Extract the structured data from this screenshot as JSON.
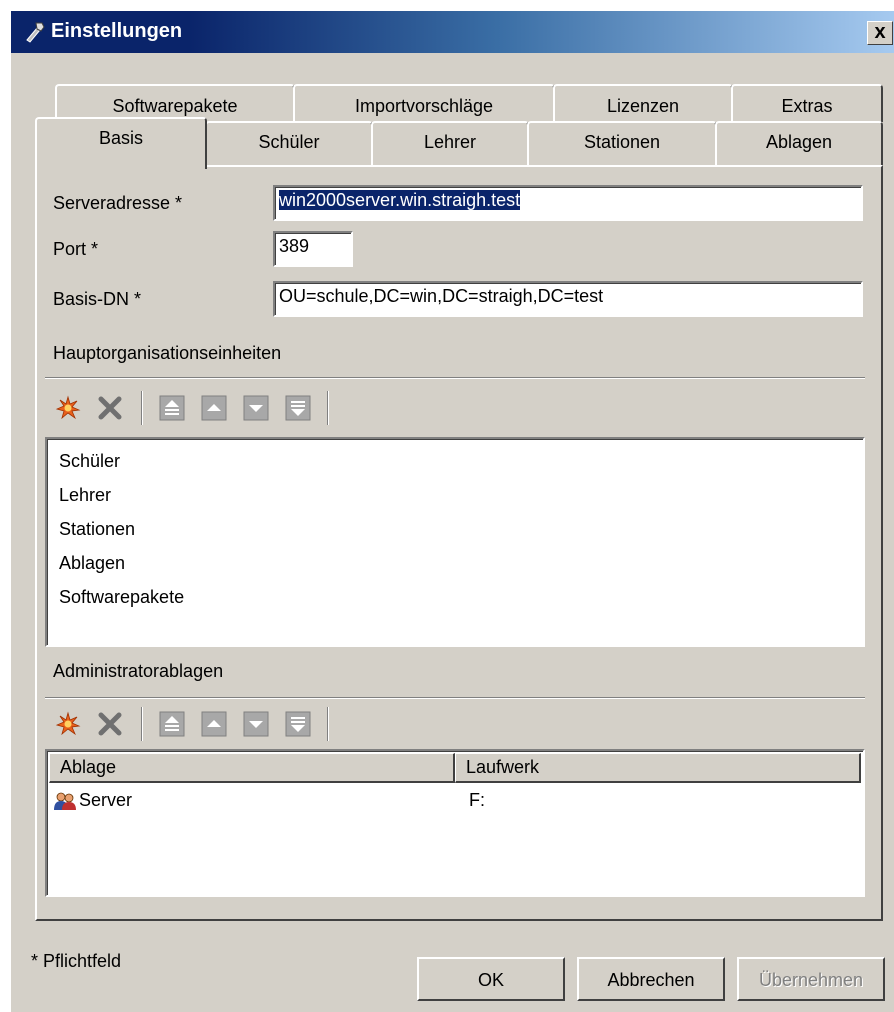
{
  "window": {
    "title": "Einstellungen",
    "close_glyph": "x"
  },
  "tabs": {
    "row1": [
      "Softwarepakete",
      "Importvorschläge",
      "Lizenzen",
      "Extras"
    ],
    "row2": [
      "Basis",
      "Schüler",
      "Lehrer",
      "Stationen",
      "Ablagen"
    ],
    "active": "Basis"
  },
  "form": {
    "server_label": "Serveradresse *",
    "server_value": "win2000server.win.straigh.test",
    "port_label": "Port *",
    "port_value": "389",
    "basedn_label": "Basis-DN *",
    "basedn_value": "OU=schule,DC=win,DC=straigh,DC=test"
  },
  "main_units": {
    "label": "Hauptorganisationseinheiten",
    "items": [
      "Schüler",
      "Lehrer",
      "Stationen",
      "Ablagen",
      "Softwarepakete"
    ]
  },
  "admin_stores": {
    "label": "Administratorablagen",
    "columns": [
      "Ablage",
      "Laufwerk"
    ],
    "rows": [
      {
        "name": "Server",
        "drive": "F:"
      }
    ]
  },
  "toolbar_icons": [
    "add-icon",
    "delete-icon",
    "move-top-icon",
    "move-up-icon",
    "move-down-icon",
    "move-bottom-icon"
  ],
  "footer": {
    "required_note": "* Pflichtfeld",
    "ok": "OK",
    "cancel": "Abbrechen",
    "apply": "Übernehmen"
  },
  "colors": {
    "title_start": "#0a246a",
    "title_end": "#a6caf0",
    "selection": "#0a246a",
    "face": "#d4d0c8",
    "add_icon": "#e8601c"
  }
}
